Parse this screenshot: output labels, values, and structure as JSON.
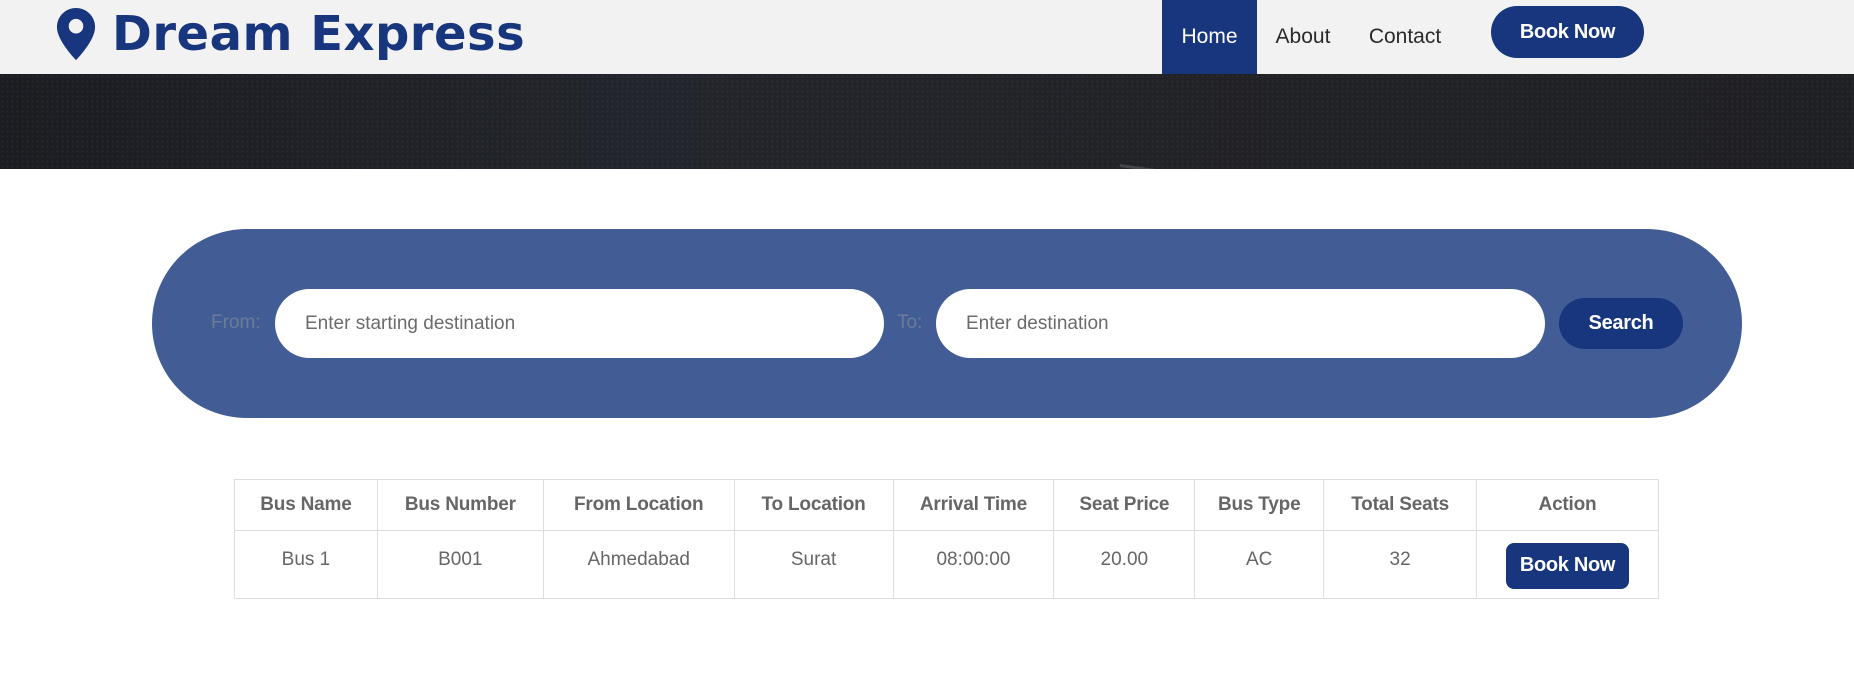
{
  "brand": {
    "name": "Dream Express",
    "icon": "map-pin-icon",
    "color": "#17367e"
  },
  "nav": {
    "items": [
      {
        "label": "Home",
        "active": true
      },
      {
        "label": "About",
        "active": false
      },
      {
        "label": "Contact",
        "active": false
      }
    ],
    "book_label": "Book Now"
  },
  "search": {
    "from_label": "From:",
    "from_placeholder": "Enter starting destination",
    "from_value": "",
    "to_label": "To:",
    "to_placeholder": "Enter destination",
    "to_value": "",
    "button_label": "Search",
    "panel_color": "#425d96"
  },
  "table": {
    "headers": [
      "Bus Name",
      "Bus Number",
      "From Location",
      "To Location",
      "Arrival Time",
      "Seat Price",
      "Bus Type",
      "Total Seats",
      "Action"
    ],
    "rows": [
      {
        "bus_name": "Bus 1",
        "bus_number": "B001",
        "from": "Ahmedabad",
        "to": "Surat",
        "arrival": "08:00:00",
        "price": "20.00",
        "type": "AC",
        "seats": "32",
        "action_label": "Book Now"
      }
    ]
  }
}
